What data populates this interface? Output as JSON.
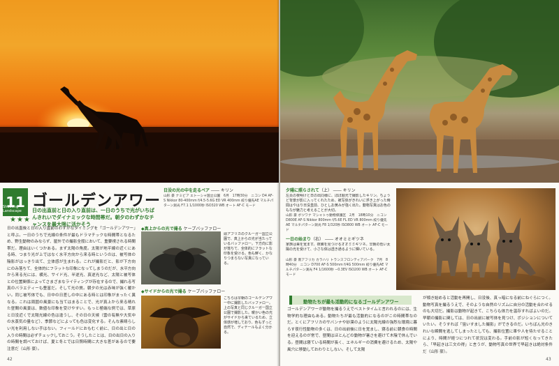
{
  "left_page": {
    "number": "42",
    "badge_number": "11",
    "badge_sub": "Shooting Landscape",
    "headline": "ゴールデンアワー",
    "lead": "日の出直前と日の入り直前は、一日のうちで光がいちばんきれいでダイナミックな時間帯だ。朝夕のわずかなチャンスを最大限に活かそう",
    "stars": "★★★",
    "body": "日の出直後と日の入り直前のわずかなタイミングを「ゴールデンアワー」と呼ぶ。一日のうちで光線の条件が最もドラマチックな時間帯となるため、野生動物のみならず、屋外での撮影全般において、重要視される時間帯だ。理由はいくつかある。まず太陽の角度。太陽が地平線の近くにある時、つまり光が上ではなく水平方向から来る時というのは、被写体の陰影がはっきり出て、立体感が生まれる。これが撮影だと、影が下方向にのみ落ちて、全体的にフラットな印象になってしまうのだが、水平方向から来る光には、横光、サイド光、半逆光、真逆光など、太陽と被写体との位置関係によってさまざまなライティングが存在するので、撮れる写真のバラエティーも豊富だ。",
    "body2": "そして光の質。朝夕の光は赤味が強く暖かい。同じ被写体でも、日中の日差しの中にある時とは印象がまったく異なる。これは周囲の風景にも当てはまることで、光が真上から来る晴れた昼間の風景は、数値な印象を受けやすい。もっと極端な例では、草原と日没近くで太陽光線の色は違うし、その日の天候（雲の有無や大気中の水蒸気の量など）、季節などによっても色は変化する。そんな素晴らしい光を利用しない手はない。フィールドにおもむく前に、日の出と日の入りの時間は必ずチェックしておこう。そうしたことは、日の出日の入りの時間を調べておけば、夏と冬とでは日照時間に大きな差があるので要注意だ（山形 豪）。",
    "caption_top": {
      "title": "日没の光の中を走るペア",
      "subject": "キリン",
      "data": "山形 豪 ナミビア エトーシャ国立公園　6月　17時30分　ニコン D4 AF-S Nikkor 80-400mm f/4.5-5.6G ED VR 400mm 絞り優先AE マルチパターン測光 F7.1 1/1000秒 ISO320 WB オート AF-C モード"
    },
    "caption_middle": {
      "title": "真上からの光で撮る",
      "subject": "ケープバッファロー",
      "text": "頭アフリカのクルーガー国立公園で、真上からの光が当たっているバッファロー。下方向に影が落ちて、全体的にフラットな印象を受ける。色も鮮く、かなりつまらない写真になっている。"
    },
    "caption_bottom": {
      "title": "サイドからの光で撮る",
      "subject": "ケープバッファロー",
      "text": "こちらは早朝のゴールデンアワー中に撮影したバッファロー。上の写真と同じクルーガー国立公園で撮影した。暖かい色の光がサイドから来ているため、立体感が増しており、色もずっと自然で、ディテールもよく分かる。"
    }
  },
  "right_page": {
    "number": "43",
    "caption_giraffe": {
      "title": "夕陽に照らされて",
      "tag": "（上）",
      "subject": "キリン",
      "text": "左頁の夜明けと日の出同様に、ほぼ順光で撮影したキリン。ちょうど背景が影に入ってくれたため、被写体がきれいに浮き上がった時間はやはり日没直前、ひとしお黄みが強く出た。動物写真はお色のもなが魅力と考えることが大切。",
      "data": "山形 豪 ボツワナ マシャトゥ動物保護区　2月　18時10分　ニコン D800E AF-S Nikkor 800mm f/5.6E FL ED VR 800mm 絞り優先AE マルチパターン測光 F8 1/320秒 ISO800 WB オート AF-C モード"
    },
    "caption_fox": {
      "title": "一日の始まり",
      "tag": "（右）",
      "subject": "オオミミギツネ",
      "text": "家族は巣を覚ます。夜餌を見つけるオオミミギツネ。早朝の低い太陽の光を受けて、小さな体は透き通るように輝いている。",
      "data": "山形 豪 南アフリカ カラハリ トランスフロンティアパーク　7月　8時40分　ニコン D700 AF-S 500mm f/4G 500mm 絞り優先AE マルチパターン測光 F4 1/1600秒 −0.3EV ISO200 WB オート AF-C モード"
    },
    "section_title": "動物たちが最も活動的になるゴールデンアワー",
    "body": "ゴールデンアワーが動物を撮るうえでベストタイムと言われるのには、生物学的な理由もある。動物たちが最も活動的になるのがこの時間帯なのだ。とくにアフリカのサバンナや砂漠のように太陽光線の強烈な環境に暮らす夜行性動物の多くは、日の出前後に日を覚まし、寝る前に朝食の時間を迎えるのが常で、昼間はほとんどの動物が暑さを避けて木陰で休んでいる。昼間は寝ている時間が長く、エネルギーの消費を避けるため、太陽や風穴に移動しておわりとしない。そして太陽",
    "body2": "が傾き始めると活動を再開し、日没後、真っ暗になる前にねぐらにつく。動物写真を撮るうえで、そのような自然のリズムに自分の活動を合わせるのも大切だ。撮影は動物が起きて、こちらも体力を温存すればよいのだ。早朝の撮影に関しては、日の出前に被写体を見つけ、ポジションについていたい。そうすれば「狙いすました撮影」ができるのだ。いちばん光のきれいな瞬間を逃してしまったとしても、撮影位置に車や人を待たせることにより、時間が経つにつれて状況は変わる。手前の影が短くなってきたら、「早起きは三文の得」と言うが、動物写真の世界で早起きは絶対条件だ（山形 豪）。"
  }
}
